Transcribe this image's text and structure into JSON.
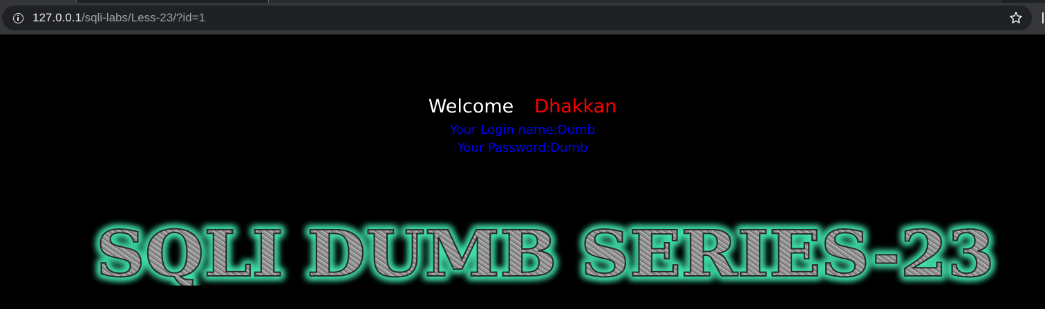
{
  "browser": {
    "url_host": "127.0.0.1",
    "url_path": "/sqli-labs/Less-23/?id=1"
  },
  "content": {
    "welcome_label": "Welcome",
    "welcome_name": "Dhakkan",
    "login_name_text": "Your Login name:Dumb",
    "password_text": "Your Password:Dumb",
    "banner_text": "SQLI DUMB SERIES-23"
  },
  "colors": {
    "page_background": "#000000",
    "welcome_label": "#ffffff",
    "welcome_name": "#ff0000",
    "credentials": "#0000ff",
    "banner_glow": "#3fe0a8",
    "banner_fill": "#9a9a9a"
  },
  "icons": {
    "site_info": "info-icon",
    "bookmark": "star-icon"
  }
}
